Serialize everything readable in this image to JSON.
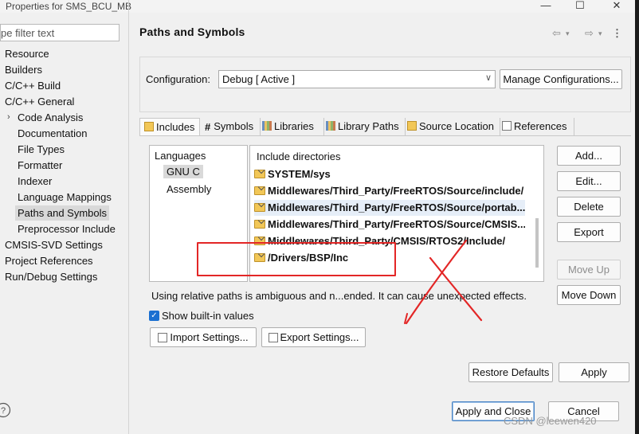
{
  "window": {
    "title": "Properties for SMS_BCU_MB",
    "minimize": "—",
    "maximize": "☐",
    "close": "✕"
  },
  "filter": {
    "value": "pe filter text"
  },
  "sidebar": {
    "items": [
      {
        "label": "Resource"
      },
      {
        "label": "Builders"
      },
      {
        "label": "C/C++ Build"
      },
      {
        "label": "C/C++ General"
      },
      {
        "label": "Code Analysis"
      },
      {
        "label": "Documentation"
      },
      {
        "label": "File Types"
      },
      {
        "label": "Formatter"
      },
      {
        "label": "Indexer"
      },
      {
        "label": "Language Mappings"
      },
      {
        "label": "Paths and Symbols"
      },
      {
        "label": "Preprocessor Include"
      },
      {
        "label": "CMSIS-SVD Settings"
      },
      {
        "label": "Project References"
      },
      {
        "label": "Run/Debug Settings"
      }
    ]
  },
  "header": {
    "title": "Paths and Symbols"
  },
  "config": {
    "label": "Configuration:",
    "value": "Debug  [ Active ]",
    "manage_label": "Manage Configurations..."
  },
  "tabs": [
    {
      "label": "Includes"
    },
    {
      "label": "Symbols"
    },
    {
      "label": "Libraries"
    },
    {
      "label": "Library Paths"
    },
    {
      "label": "Source Location"
    },
    {
      "label": "References"
    }
  ],
  "languages": {
    "header": "Languages",
    "items": [
      {
        "label": "GNU C"
      },
      {
        "label": "Assembly"
      }
    ]
  },
  "includes": {
    "header": "Include directories",
    "rows": [
      {
        "path": "SYSTEM/sys"
      },
      {
        "path": "Middlewares/Third_Party/FreeRTOS/Source/include/"
      },
      {
        "path": "Middlewares/Third_Party/FreeRTOS/Source/portab..."
      },
      {
        "path": "Middlewares/Third_Party/FreeRTOS/Source/CMSIS..."
      },
      {
        "path": "Middlewares/Third_Party/CMSIS/RTOS2/Include/"
      },
      {
        "path": "/Drivers/BSP/Inc"
      }
    ]
  },
  "side_buttons": {
    "add": "Add...",
    "edit": "Edit...",
    "delete": "Delete",
    "export": "Export",
    "move_up": "Move Up",
    "move_down": "Move Down"
  },
  "status": {
    "text": "Using relative paths is ambiguous and n...ended. It can cause unexpected effects."
  },
  "show_builtin": {
    "label": "Show built-in values",
    "checked": true
  },
  "settings_buttons": {
    "import": "Import Settings...",
    "export": "Export Settings..."
  },
  "footer": {
    "restore_defaults": "Restore Defaults",
    "apply": "Apply",
    "apply_close": "Apply and Close",
    "cancel": "Cancel"
  },
  "watermark": {
    "text": "CSDN @leewen420"
  },
  "colors": {
    "annotation_red": "#e32626",
    "accent_blue": "#1a6fd1"
  }
}
